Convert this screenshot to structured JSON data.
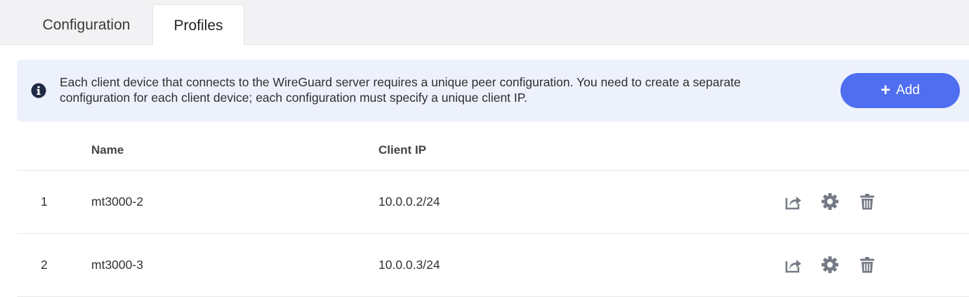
{
  "tabs": [
    {
      "label": "Configuration",
      "active": false
    },
    {
      "label": "Profiles",
      "active": true
    }
  ],
  "banner": {
    "icon": "info-icon",
    "text_line1": "Each client device that connects to the WireGuard server requires a unique peer configuration. You need to create a separate",
    "text_line2": "configuration for each client device; each configuration must specify a unique client IP.",
    "add_button": {
      "icon": "plus-icon",
      "label": "Add"
    }
  },
  "table": {
    "columns": [
      "",
      "Name",
      "Client IP",
      ""
    ],
    "rows": [
      {
        "index": "1",
        "name": "mt3000-2",
        "client_ip": "10.0.0.2/24"
      },
      {
        "index": "2",
        "name": "mt3000-3",
        "client_ip": "10.0.0.3/24"
      }
    ],
    "row_actions": [
      "export-icon",
      "gear-icon",
      "trash-icon"
    ]
  },
  "colors": {
    "accent": "#4f6ff0",
    "banner_bg": "#edf1fc",
    "icon_gray": "#757b85",
    "tabbar_bg": "#f2f2f4"
  }
}
